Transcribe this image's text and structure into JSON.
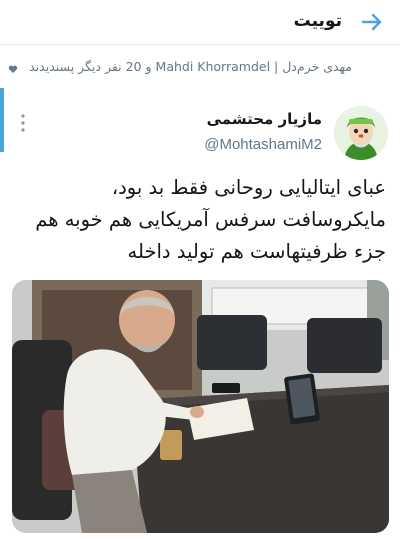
{
  "header": {
    "title": "توییت",
    "back_icon": "arrow-right-icon"
  },
  "social_context": {
    "text": "مهدی خرم‌دل | Mahdi Khorramdel و 20 نفر دیگر پسندیدند",
    "icon": "heart-icon"
  },
  "author": {
    "name": "مازیار محتشمی",
    "handle": "@MohtashamiM2"
  },
  "tweet": {
    "lines": [
      "عبای ایتالیایی روحانی فقط بد بود،",
      "مایکروسافت سرفس آمریکایی هم خوبه هم",
      "جزء ظرفیتهاست هم تولید داخله"
    ]
  },
  "colors": {
    "accent": "#4aa3df",
    "secondary_text": "#657786",
    "text": "#14171a"
  }
}
